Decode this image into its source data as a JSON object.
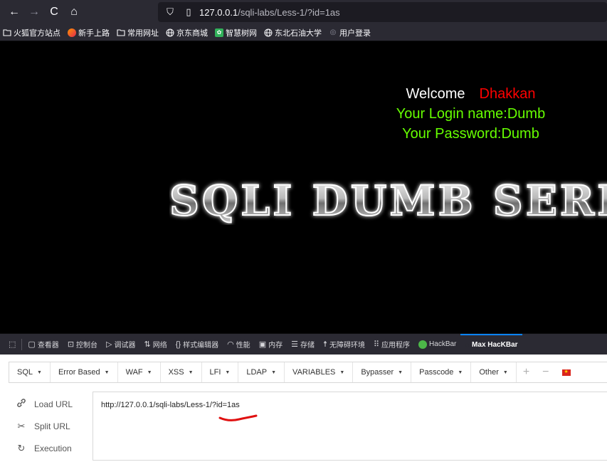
{
  "browser": {
    "url_host": "127.0.0.1",
    "url_path": "/sqli-labs/Less-1/?id=1as",
    "nav": {
      "back": "←",
      "forward": "→",
      "reload": "C",
      "home": "⌂"
    }
  },
  "bookmarks": [
    {
      "label": "火狐官方站点",
      "icon": "folder-icon"
    },
    {
      "label": "新手上路",
      "icon": "firefox-icon"
    },
    {
      "label": "常用网址",
      "icon": "folder-icon"
    },
    {
      "label": "京东商城",
      "icon": "globe-icon"
    },
    {
      "label": "智慧树网",
      "icon": "green-square-icon"
    },
    {
      "label": "东北石油大学",
      "icon": "globe-icon"
    },
    {
      "label": "用户登录",
      "icon": "gray-dot-icon"
    }
  ],
  "page": {
    "welcome_label": "Welcome",
    "welcome_name": "Dhakkan",
    "login_line": "Your Login name:Dumb",
    "password_line": "Your Password:Dumb",
    "banner_text": "SQLI DUMB SERIES"
  },
  "devtools": {
    "tabs": [
      {
        "label": "查看器",
        "icon": "inspector-icon"
      },
      {
        "label": "控制台",
        "icon": "console-icon"
      },
      {
        "label": "调试器",
        "icon": "debugger-icon"
      },
      {
        "label": "网络",
        "icon": "network-icon"
      },
      {
        "label": "样式编辑器",
        "icon": "style-editor-icon"
      },
      {
        "label": "性能",
        "icon": "performance-icon"
      },
      {
        "label": "内存",
        "icon": "memory-icon"
      },
      {
        "label": "存储",
        "icon": "storage-icon"
      },
      {
        "label": "无障碍环境",
        "icon": "accessibility-icon"
      },
      {
        "label": "应用程序",
        "icon": "application-icon"
      },
      {
        "label": "HackBar",
        "icon": "hackbar-icon"
      },
      {
        "label": "Max HacKBar",
        "icon": "max-hackbar-icon"
      }
    ]
  },
  "hackbar": {
    "menu": [
      "SQL",
      "Error Based",
      "WAF",
      "XSS",
      "LFI",
      "LDAP",
      "VARIABLES",
      "Bypasser",
      "Passcode",
      "Other"
    ],
    "actions": [
      {
        "label": "Load URL",
        "icon": "link-icon"
      },
      {
        "label": "Split URL",
        "icon": "scissors-icon"
      },
      {
        "label": "Execution",
        "icon": "refresh-icon"
      }
    ],
    "url_value": "http://127.0.0.1/sqli-labs/Less-1/?id=1as"
  },
  "colors": {
    "welcome_name": "#ff0000",
    "login_text": "#66ff00",
    "chrome_bg": "#2b2a33"
  }
}
